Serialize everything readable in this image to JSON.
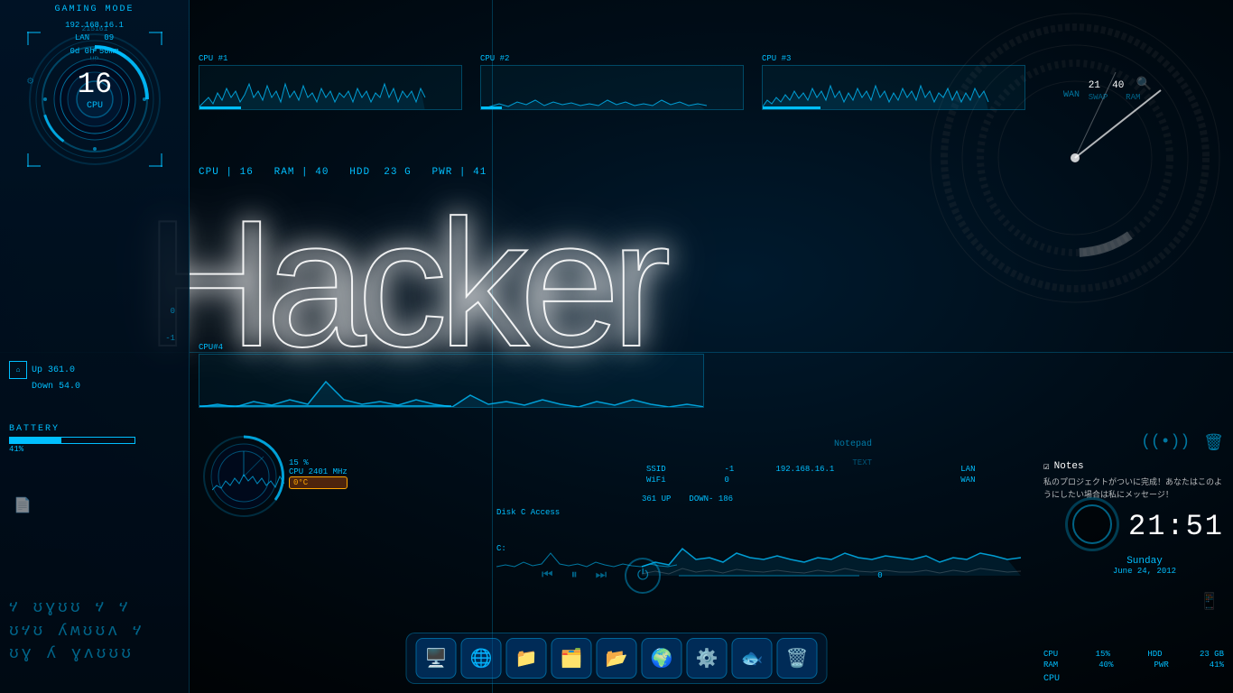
{
  "background": {
    "color": "#000010"
  },
  "hacker_title": "Hacker",
  "left_panel": {
    "cpu_gauge": {
      "value": "16",
      "label": "CPU",
      "title": "215161"
    },
    "gaming_mode": "GAMING MODE",
    "lan_ip": "192.168.16.1",
    "lan_label": "LAN",
    "lan_port": "09",
    "uptime": "0d 0h 50mm",
    "uptime_label": "UP",
    "zero": "0",
    "minus_one": "-1",
    "net_up": "Up 361.0",
    "net_down": "Down 54.0",
    "battery_label": "BATTERY",
    "battery_pct": "41%",
    "script_line1": "ሃ ʊɣʊʊ ሃ ሃ",
    "script_line2": "ʊሃʊ ʎʍʊʊʌ ሃ",
    "script_line3": "ʊɣ ʎ ɣʌʊʊʊ"
  },
  "cpu_panels": {
    "cpu1_label": "CPU #1",
    "cpu2_label": "CPU #2",
    "cpu3_label": "CPU #3",
    "cpu4_label": "CPU#4",
    "cpu1_val": 16,
    "cpu2_val": 8,
    "cpu3_val": 22
  },
  "stats_bar": {
    "cpu_label": "CPU",
    "cpu_val": "16",
    "ram_label": "RAM",
    "ram_val": "40",
    "hdd_label": "HDD",
    "hdd_val": "23 G",
    "pwr_label": "PWR",
    "pwr_val": "41"
  },
  "cpu4_panel": {
    "label": "CPU#4",
    "freq": "CPU 2401 MHz",
    "pct": "15 %",
    "temp": "0°C"
  },
  "disk_section": {
    "label": "Disk C Access",
    "drive": "C:",
    "value": "0"
  },
  "media_controls": {
    "prev": "⏮",
    "pause": "⏸",
    "next": "⏭"
  },
  "network_widget": {
    "ssid_label": "SSID",
    "ssid_val": "-1",
    "ip_val": "192.168.16.1",
    "lan_label": "LAN",
    "wifi_label": "WiFi",
    "wifi_val": "0",
    "wan_label": "WAN",
    "up_label": "UP",
    "up_val": "361",
    "down_label": "DOWN",
    "down_val": "186"
  },
  "notepad_label": "Notepad",
  "notepad_text_label": "TEXT",
  "right_panel": {
    "wan_label": "WAN",
    "swap_val": "21",
    "swap_label": "SWAP",
    "ram_val": "40",
    "ram_label": "RAM"
  },
  "notes": {
    "title": "Notes",
    "text": "私のプロジェクトがついに完成！あなたはこのようにしたい場合は私にメッセージ！"
  },
  "clock": {
    "time": "21:51",
    "day": "Sunday",
    "date": "June 24, 2012"
  },
  "bottom_stats": {
    "cpu_label": "CPU",
    "cpu_val": "15%",
    "ram_label": "RAM",
    "ram_val": "40%",
    "hdd_label": "HDD",
    "hdd_val": "23 GB",
    "pwr_label": "PWR",
    "pwr_val": "41%"
  },
  "dock": {
    "icons": [
      "🖥️",
      "🌐",
      "📁",
      "🗂️",
      "📂",
      "🌍",
      "⚙️",
      "🐟",
      "🗑️"
    ]
  },
  "accent_color": "#00bfff",
  "icons": {
    "wifi": "((•))",
    "trash": "🗑",
    "notes_check": "☑",
    "power": "⏻",
    "home": "⌂",
    "battery": "🔋",
    "phone": "📱"
  }
}
